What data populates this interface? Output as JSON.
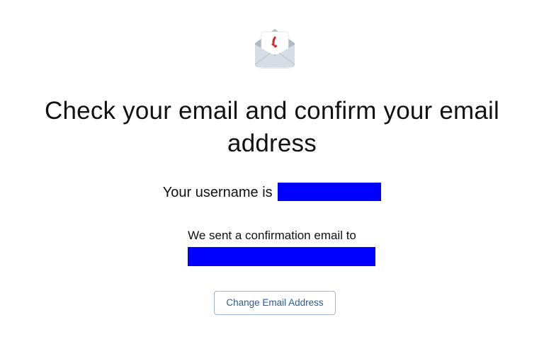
{
  "icon": {
    "name": "email-envelope-icon"
  },
  "headline": "Check your email and confirm your email address",
  "username": {
    "label": "Your username is",
    "value_redacted": true
  },
  "confirmation": {
    "label": "We sent a confirmation email to",
    "email_redacted": true
  },
  "change_email_button": {
    "label": "Change Email Address"
  },
  "colors": {
    "redaction": "#0000ff",
    "button_text": "#2a5d9c",
    "button_border": "#9db8d9",
    "envelope_body": "#d6dde4",
    "brand_red": "#d42a2a"
  }
}
